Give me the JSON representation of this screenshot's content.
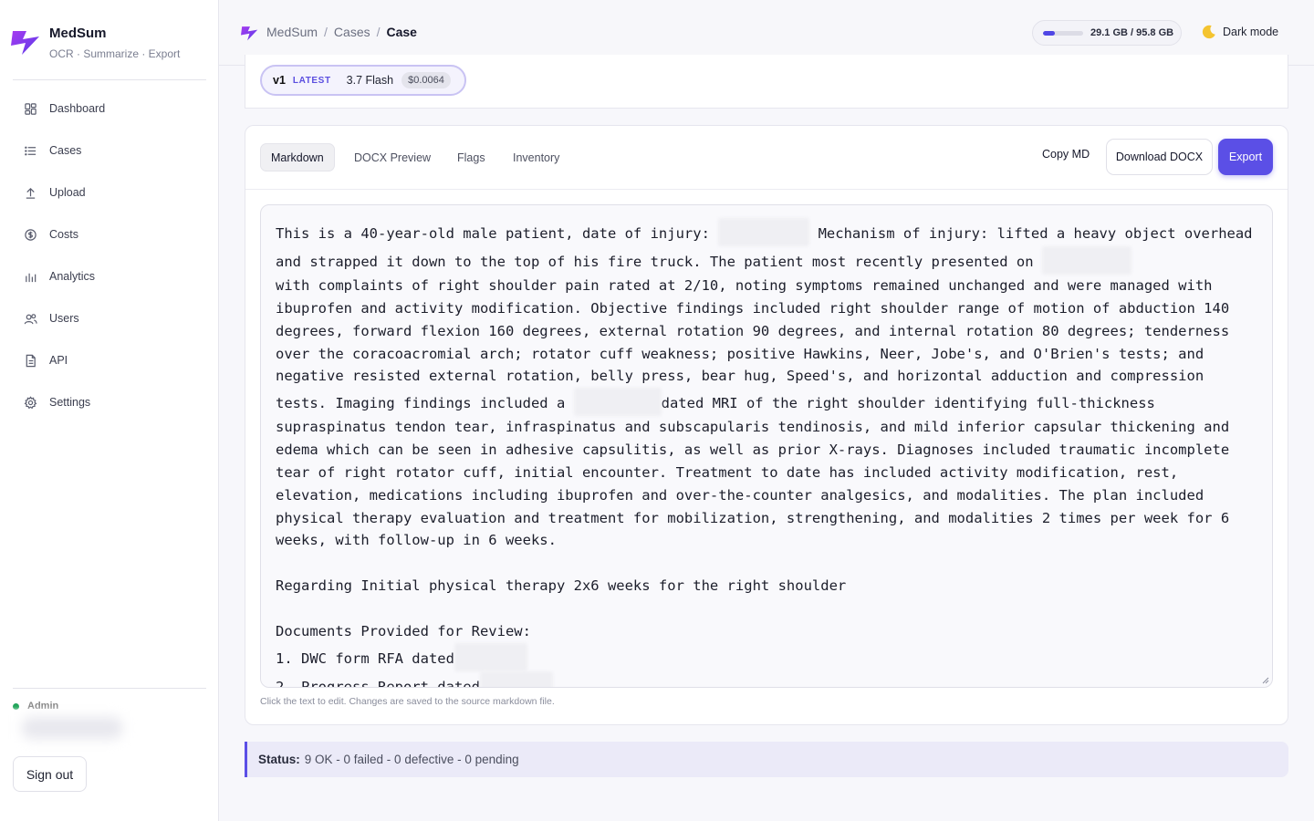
{
  "app": {
    "name": "MedSum",
    "tagline": "OCR · Summarize · Export"
  },
  "sidebar": {
    "items": [
      {
        "label": "Dashboard",
        "icon": "dashboard-icon"
      },
      {
        "label": "Cases",
        "icon": "list-icon"
      },
      {
        "label": "Upload",
        "icon": "upload-icon"
      },
      {
        "label": "Costs",
        "icon": "dollar-icon"
      },
      {
        "label": "Analytics",
        "icon": "bar-chart-icon"
      },
      {
        "label": "Users",
        "icon": "users-icon"
      },
      {
        "label": "API",
        "icon": "document-icon"
      },
      {
        "label": "Settings",
        "icon": "gear-icon"
      }
    ],
    "role": "Admin",
    "sign_out": "Sign out"
  },
  "breadcrumb": {
    "root": "MedSum",
    "section": "Cases",
    "current": "Case"
  },
  "storage": {
    "text": "29.1 GB / 95.8 GB",
    "used_fraction": 0.304
  },
  "dark_mode_label": "Dark mode",
  "version": {
    "number": "v1",
    "badge": "LATEST",
    "model": "3.7 Flash",
    "cost": "$0.0064"
  },
  "tabs": [
    "Markdown",
    "DOCX Preview",
    "Flags",
    "Inventory"
  ],
  "actions": {
    "copy": "Copy MD",
    "download": "Download DOCX",
    "export": "Export"
  },
  "document": {
    "p1_a": "This is a 40-year-old male patient, date of injury: ",
    "p1_b": " Mechanism of injury: lifted a heavy object overhead and strapped it down to the top of his fire truck. The patient most recently presented on ",
    "p1_c": "\nwith complaints of right shoulder pain rated at 2/10, noting symptoms remained unchanged and were managed with ibuprofen and activity modification. Objective findings included right shoulder range of motion of abduction 140 degrees, forward flexion 160 degrees, external rotation 90 degrees, and internal rotation 80 degrees; tenderness over the coracoacromial arch; rotator cuff weakness; positive Hawkins, Neer, Jobe's, and O'Brien's tests; and negative resisted external rotation, belly press, bear hug, Speed's, and horizontal adduction and compression tests. Imaging findings included a ",
    "p1_d": "dated MRI of the right shoulder identifying full-thickness supraspinatus tendon tear, infraspinatus and subscapularis tendinosis, and mild inferior capsular thickening and edema which can be seen in adhesive capsulitis, as well as prior X-rays. Diagnoses included traumatic incomplete tear of right rotator cuff, initial encounter. Treatment to date has included activity modification, rest, elevation, medications including ibuprofen and over-the-counter analgesics, and modalities. The plan included physical therapy evaluation and treatment for mobilization, strengthening, and modalities 2 times per week for 6 weeks, with follow-up in 6 weeks.\n\nRegarding Initial physical therapy 2x6 weeks for the right shoulder\n\nDocuments Provided for Review:\n1. DWC form RFA dated",
    "p1_e": "\n2. Progress Report dated",
    "help": "Click the text to edit. Changes are saved to the source markdown file."
  },
  "status": {
    "label": "Status:",
    "text": "9 OK - 0 failed - 0 defective - 0 pending"
  },
  "colors": {
    "accent": "#5b4fe6",
    "status_ok": "#22a55a"
  }
}
